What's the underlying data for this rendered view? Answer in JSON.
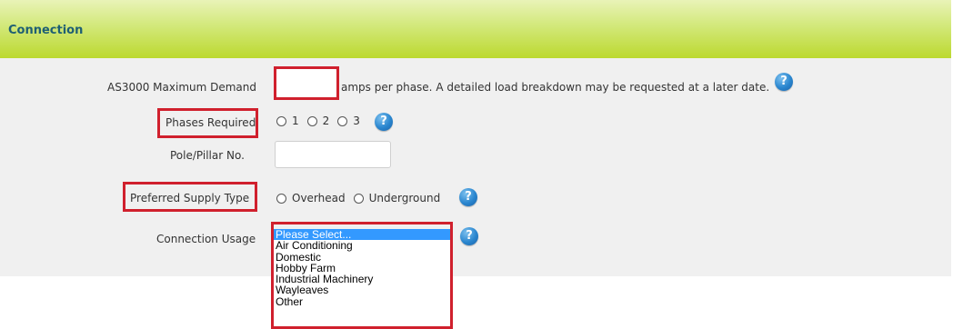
{
  "section": {
    "title": "Connection"
  },
  "fields": {
    "max_demand": {
      "label": "AS3000 Maximum Demand",
      "value": "",
      "suffix": "amps per phase. A detailed load breakdown may be requested at a later date."
    },
    "phases": {
      "label": "Phases Required",
      "options": [
        "1",
        "2",
        "3"
      ]
    },
    "pole": {
      "label": "Pole/Pillar No.",
      "value": ""
    },
    "supply_type": {
      "label": "Preferred Supply Type",
      "options": [
        "Overhead",
        "Underground"
      ]
    },
    "usage": {
      "label": "Connection Usage",
      "options": [
        "Please Select...",
        "Air Conditioning",
        "Domestic",
        "Hobby Farm",
        "Industrial Machinery",
        "Wayleaves",
        "Other"
      ],
      "selected": "Please Select..."
    }
  },
  "help_icon_glyph": "?",
  "colors": {
    "header_gradient_top": "#e9f3b7",
    "header_gradient_bottom": "#bcd92f",
    "header_text": "#1f5f73",
    "highlight_box": "#d0202d",
    "help_icon": "#2a86cf",
    "selected_option": "#3399ff"
  }
}
